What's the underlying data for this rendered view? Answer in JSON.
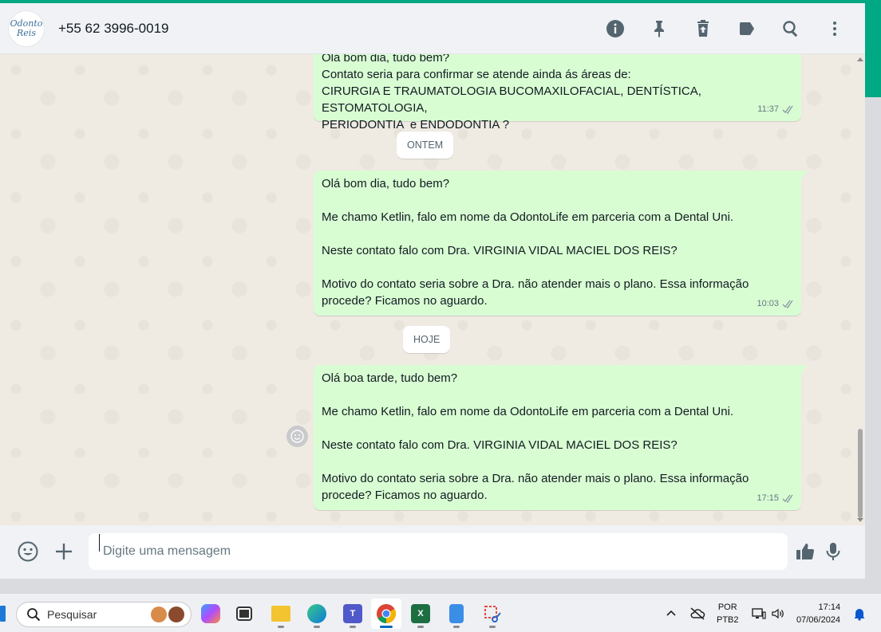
{
  "header": {
    "avatar_text": "Odonto Reis",
    "contact_name": "+55 62 3996-0019"
  },
  "chat": {
    "messages": [
      {
        "text": "Olá bom dia, tudo bem?\nContato seria para confirmar se atende ainda ás áreas de:\nCIRURGIA E TRAUMATOLOGIA BUCOMAXILOFACIAL, DENTÍSTICA, ESTOMATOLOGIA,\nPERIODONTIA  e ENDODONTIA ?",
        "time": "11:37"
      },
      {
        "text": "Olá bom dia, tudo bem?\n\nMe chamo Ketlin, falo em nome da OdontoLife em parceria com a Dental Uni.\n\nNeste contato falo com Dra. VIRGINIA VIDAL MACIEL DOS REIS?\n\nMotivo do contato seria sobre a Dra. não atender mais o plano. Essa informação\nprocede? Ficamos no aguardo.",
        "time": "10:03"
      },
      {
        "text": "Olá boa tarde, tudo bem?\n\nMe chamo Ketlin, falo em nome da OdontoLife em parceria com a Dental Uni.\n\nNeste contato falo com Dra. VIRGINIA VIDAL MACIEL DOS REIS?\n\nMotivo do contato seria sobre a Dra. não atender mais o plano. Essa informação\nprocede? Ficamos no aguardo.",
        "time": "17:15"
      }
    ],
    "dates": [
      "ONTEM",
      "HOJE"
    ]
  },
  "composer": {
    "placeholder": "Digite uma mensagem"
  },
  "taskbar": {
    "search_label": "Pesquisar",
    "lang_line1": "POR",
    "lang_line2": "PTB2",
    "clock_time": "17:14",
    "clock_date": "07/06/2024"
  },
  "colors": {
    "accent": "#00a884",
    "outgoing_bubble": "#d9fdd3",
    "icon": "#54656f"
  }
}
